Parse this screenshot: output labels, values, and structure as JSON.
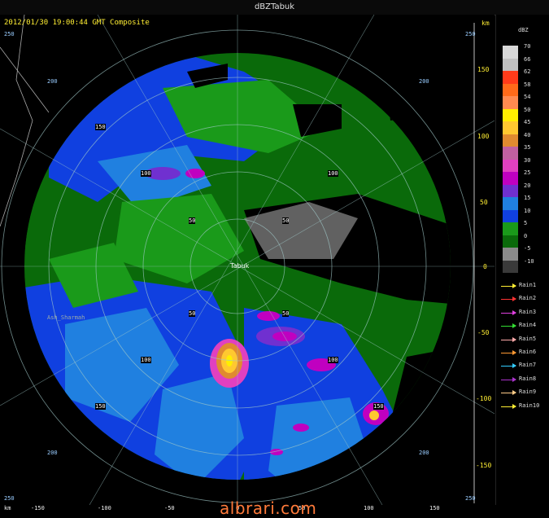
{
  "window": {
    "title": "dBZTabuk"
  },
  "radar": {
    "header": "2012/01/30 19:00:44 GMT Composite",
    "km_top": "km",
    "km_bottom": "km",
    "station": "Tabuk",
    "place": "Ash_Sharmah",
    "range_rings": [
      "50",
      "100",
      "150",
      "200"
    ]
  },
  "axes": {
    "x_ticks": [
      "-150",
      "-100",
      "-50",
      "0",
      "50",
      "100",
      "150"
    ],
    "y_ticks": [
      "150",
      "100",
      "50",
      "0",
      "-50",
      "-100",
      "-150"
    ],
    "corner_labels": [
      "250",
      "250",
      "250",
      "250"
    ]
  },
  "legend": {
    "unit": "dBZ",
    "levels": [
      {
        "label": "70",
        "color": "#d8d8d8"
      },
      {
        "label": "66",
        "color": "#c0c0c0"
      },
      {
        "label": "62",
        "color": "#ff3b1a"
      },
      {
        "label": "58",
        "color": "#ff6a1a"
      },
      {
        "label": "54",
        "color": "#ff8a50"
      },
      {
        "label": "50",
        "color": "#ffee00"
      },
      {
        "label": "45",
        "color": "#ffc830"
      },
      {
        "label": "40",
        "color": "#e08a30"
      },
      {
        "label": "35",
        "color": "#c060a0"
      },
      {
        "label": "30",
        "color": "#e040c0"
      },
      {
        "label": "25",
        "color": "#c000c0"
      },
      {
        "label": "20",
        "color": "#7030d0"
      },
      {
        "label": "15",
        "color": "#2080e0"
      },
      {
        "label": "10",
        "color": "#1040e0"
      },
      {
        "label": "5",
        "color": "#1a9a1a"
      },
      {
        "label": "0",
        "color": "#0a6a0a"
      },
      {
        "label": "-5",
        "color": "#8a8a8a"
      },
      {
        "label": "-10",
        "color": "#3a3a3a"
      }
    ],
    "rain_series": [
      {
        "label": "Rain1",
        "color": "#ffee33"
      },
      {
        "label": "Rain2",
        "color": "#ff3333"
      },
      {
        "label": "Rain3",
        "color": "#e040e0"
      },
      {
        "label": "Rain4",
        "color": "#33dd33"
      },
      {
        "label": "Rain5",
        "color": "#ffaaaa"
      },
      {
        "label": "Rain6",
        "color": "#ff9933"
      },
      {
        "label": "Rain7",
        "color": "#33ccff"
      },
      {
        "label": "Rain8",
        "color": "#aa33cc"
      },
      {
        "label": "Rain9",
        "color": "#ffcc88"
      },
      {
        "label": "Rain10",
        "color": "#ffee33"
      }
    ]
  },
  "watermark": "albrari.com"
}
